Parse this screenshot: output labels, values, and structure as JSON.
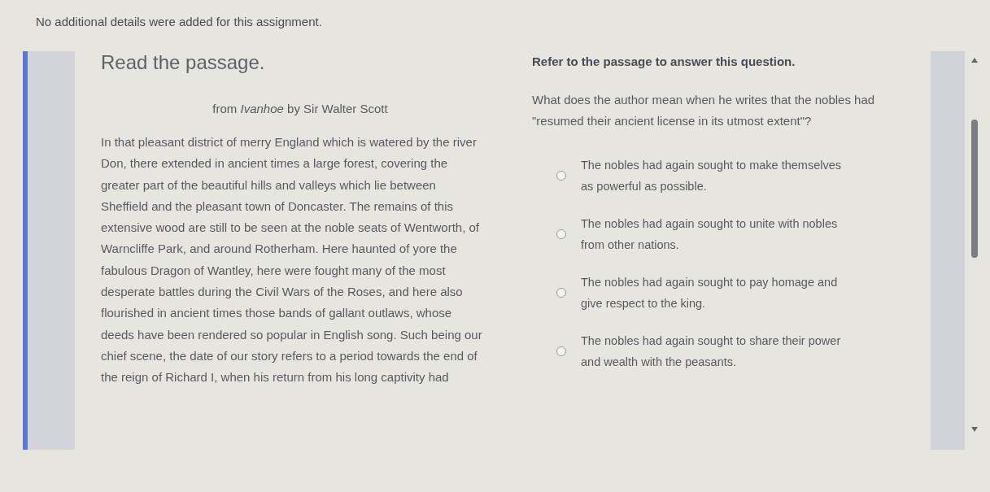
{
  "assignment_note": "No additional details were added for this assignment.",
  "passage": {
    "heading": "Read the passage.",
    "source": "from *Ivanhoe* by Sir Walter Scott",
    "text": "In that pleasant district of merry England which is watered by the river Don, there extended in ancient times a large forest, covering the greater part of the beautiful hills and valleys which lie between Sheffield and the pleasant town of Doncaster. The remains of this extensive wood are still to be seen at the noble seats of Wentworth, of Warncliffe Park, and around Rotherham. Here haunted of yore the fabulous Dragon of Wantley, here were fought many of the most desperate battles during the Civil Wars of the Roses, and here also flourished in ancient times those bands of gallant outlaws, whose deeds have been rendered so popular in English song. Such being our chief scene, the date of our story refers to a period towards the end of the reign of Richard I, when his return from his long captivity had"
  },
  "question": {
    "heading": "Refer to the passage to answer this question.",
    "prompt": "What does the author mean when he writes that the nobles had \"resumed their ancient license in its utmost extent\"?",
    "options": [
      {
        "text": "The nobles had again sought to make themselves as powerful as possible.",
        "selected": false
      },
      {
        "text": "The nobles had again sought to unite with nobles from other nations.",
        "selected": false
      },
      {
        "text": "The nobles had again sought to pay homage and give respect to the king.",
        "selected": false
      },
      {
        "text": "The nobles had again sought to share their power and wealth with the peasants.",
        "selected": false
      }
    ]
  }
}
